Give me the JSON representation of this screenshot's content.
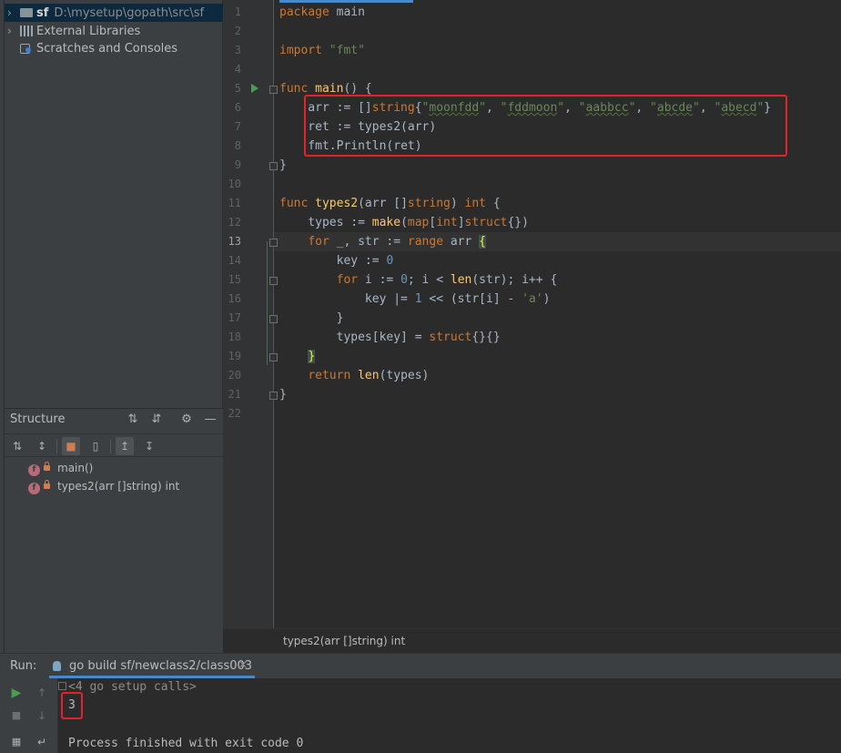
{
  "project": {
    "root_name": "sf",
    "root_path": "D:\\mysetup\\gopath\\src\\sf",
    "external_libraries": "External Libraries",
    "scratches": "Scratches and Consoles"
  },
  "structure": {
    "title": "Structure",
    "items": [
      {
        "badge": "f",
        "label": "main()"
      },
      {
        "badge": "f",
        "label": "types2(arr []string) int"
      }
    ]
  },
  "editor": {
    "line_numbers": [
      "1",
      "2",
      "3",
      "4",
      "5",
      "6",
      "7",
      "8",
      "9",
      "10",
      "11",
      "12",
      "13",
      "14",
      "15",
      "16",
      "17",
      "18",
      "19",
      "20",
      "21",
      "22"
    ],
    "current_line": "13",
    "breadcrumb": "types2(arr []string) int"
  },
  "run": {
    "label": "Run:",
    "tab_title": "go build sf/newclass2/class003",
    "console_lines": [
      "<4 go setup calls>",
      "3",
      "",
      "Process finished with exit code 0"
    ]
  },
  "colors": {
    "highlight_box": "#e5212e",
    "keyword": "#cc7832",
    "string": "#6a8759",
    "function": "#ffc66d",
    "number": "#6897bb",
    "accent": "#4a88c7"
  }
}
